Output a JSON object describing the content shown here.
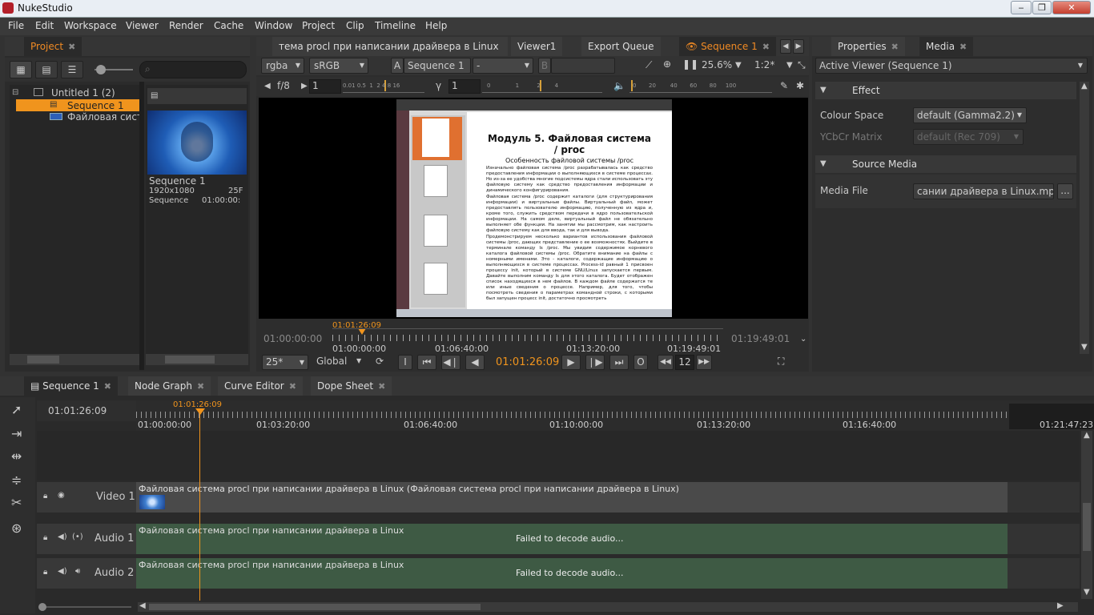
{
  "window": {
    "title": "NukeStudio",
    "min": "‒",
    "max": "❐",
    "close": "✕"
  },
  "menu": [
    "File",
    "Edit",
    "Workspace",
    "Viewer",
    "Render",
    "Cache",
    "Window",
    "Project",
    "Clip",
    "Timeline",
    "Help"
  ],
  "project": {
    "tab": "Project",
    "root": "Untitled 1 (2)",
    "seq": "Sequence 1",
    "clip": "Файловая систе",
    "card": {
      "name": "Sequence 1",
      "res": "1920x1080",
      "fps": "25F",
      "type": "Sequence",
      "tc": "01:00:00:"
    }
  },
  "viewer": {
    "tabs": [
      "тема procl при написании драйвера в Linux",
      "Viewer1",
      "Export Queue",
      "Sequence 1"
    ],
    "channel": "rgba",
    "lut": "sRGB",
    "a_label": "A",
    "a_input": "Sequence 1",
    "b_sep": "-",
    "b_label": "B",
    "zoom": "25.6%",
    "ratio": "1:2*",
    "fstop": "f/8",
    "gain": "1",
    "gamma_label": "γ",
    "gamma": "1",
    "gain_ticks": [
      "0.01",
      "0.5",
      "1",
      "2",
      "4",
      "8",
      "16"
    ],
    "gamma_ticks": [
      "0",
      "1",
      "2",
      "4"
    ],
    "vol_ticks": [
      "0",
      "20",
      "40",
      "60",
      "80",
      "100"
    ],
    "doc": {
      "title": "Модуль 5. Файловая система / proc",
      "subtitle": "Особенность файловой системы /proc",
      "para1": "Изначально файловая система /proc разрабатывалась как средство предоставления информации о выполняющихся в системе процессах. Но из-за ее удобства многие подсистемы ядра стали использовать эту файловую систему как средство предоставления информации и динамического конфигурирования.",
      "para2": "Файловая система /proc содержит каталоги (для структурирования информации) и виртуальные файлы. Виртуальный файл, может предоставлять пользователю информацию, полученную из ядра и, кроме того, служить средством передачи в ядро пользовательской информации. На самом деле, виртуальный файл не обязательно выполняет обе функции. На занятии мы рассмотрим, как настроить файловую систему как для ввода, так и для вывода.",
      "para3": "Продемонстрируем несколько вариантов использования файловой системы /proc, дающих представление о ее возможностях. Выйдите в терминале команду ls /proc. Мы увидим содержимое корневого каталога файловой системы /proc. Обратите внимание на файлы с номерными именами. Это - каталоги, содержащие информацию о выполняющихся в системе процессах. Process-id равный 1 присвоен процессу init, который в системе GNU/Linux запускается первым. Давайте выполним команду ls для этого каталога. Будет отображен список находящихся в нем файлов. В каждом файле содержатся те или иные сведения о процессе. Например, для того, чтобы посмотреть сведения о параметрах командной строки, с которыми был запущен процесс init, достаточно просмотреть"
    },
    "tc_start": "01:00:00:00",
    "tc_end": "01:19:49:01",
    "playhead": "01:01:26:09",
    "ruler": [
      "01:00:00:00",
      "01:06:40:00",
      "01:13:20:00",
      "01:19:49:01"
    ],
    "fps": "25*",
    "mode": "Global",
    "in": "I",
    "out": "O",
    "current_tc": "01:01:26:09",
    "step": "12"
  },
  "properties": {
    "tabs": [
      "Properties",
      "Media"
    ],
    "active_viewer": "Active Viewer (Sequence 1)",
    "effect": "Effect",
    "colour_space_label": "Colour Space",
    "colour_space": "default (Gamma2.2)",
    "ycbcr_label": "YCbCr Matrix",
    "ycbcr": "default (Rec 709)",
    "source_media": "Source Media",
    "media_file_label": "Media File",
    "media_file": "сании драйвера в Linux.mp4",
    "browse": "..."
  },
  "timeline": {
    "tabs": [
      "Sequence 1",
      "Node Graph",
      "Curve Editor",
      "Dope Sheet"
    ],
    "tc": "01:01:26:09",
    "playhead": "01:01:26:09",
    "ruler": [
      "01:00:00:00",
      "01:03:20:00",
      "01:06:40:00",
      "01:10:00:00",
      "01:13:20:00",
      "01:16:40:00",
      "01:21:47:23"
    ],
    "video_track": "Video 1",
    "video_clip": "Файловая система procl при написании драйвера в Linux (Файловая система procl при написании драйвера в Linux)",
    "audio1": "Audio 1",
    "audio2": "Audio 2",
    "audio_clip": "Файловая система procl при написании драйвера в Linux",
    "audio_msg": "Failed to decode audio..."
  }
}
